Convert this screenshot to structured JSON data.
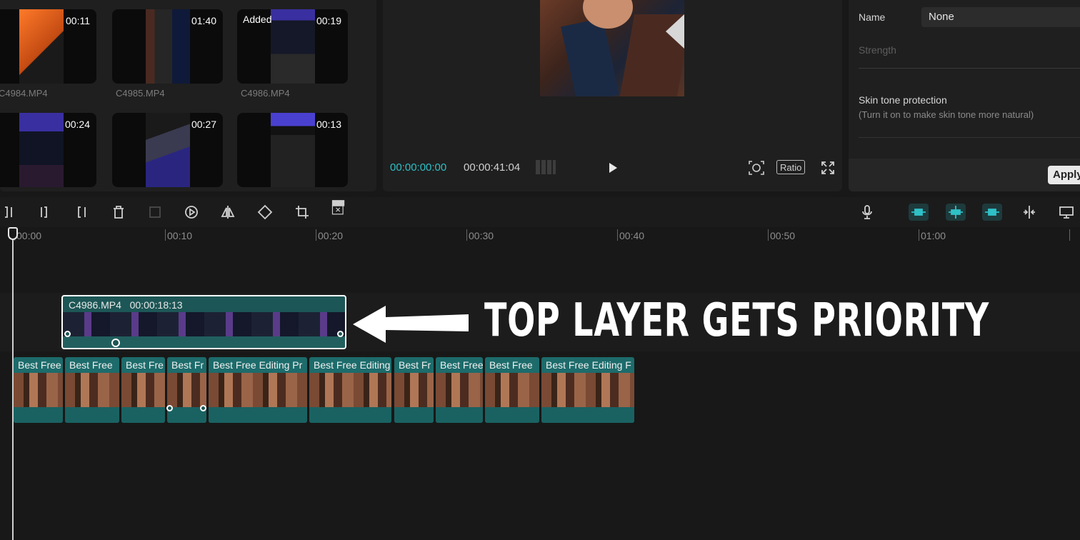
{
  "media": {
    "items": [
      {
        "duration": "00:11",
        "filename": "C4984.MP4",
        "added": ""
      },
      {
        "duration": "01:40",
        "filename": "C4985.MP4",
        "added": ""
      },
      {
        "duration": "00:19",
        "filename": "C4986.MP4",
        "added": "Added"
      },
      {
        "duration": "00:24",
        "filename": "",
        "added": ""
      },
      {
        "duration": "00:27",
        "filename": "",
        "added": ""
      },
      {
        "duration": "00:13",
        "filename": "",
        "added": ""
      }
    ]
  },
  "player": {
    "current_time": "00:00:00:00",
    "total_time": "00:00:41:04",
    "ratio_label": "Ratio"
  },
  "properties": {
    "name_label": "Name",
    "name_value": "None",
    "strength_label": "Strength",
    "skin_tone_label": "Skin tone protection",
    "skin_tone_help": "(Turn it on to make skin tone more natural)",
    "apply_label": "Apply"
  },
  "ruler": {
    "ticks": [
      "00:00",
      "00:10",
      "00:20",
      "00:30",
      "00:40",
      "00:50",
      "01:00"
    ]
  },
  "timeline": {
    "overlay_clip": {
      "name": "C4986.MP4",
      "duration": "00:00:18:13"
    },
    "main_clips": [
      "Best Free",
      "Best Free",
      "Best Fre",
      "Best Fr",
      "Best Free Editing Pr",
      "Best Free Editing",
      "Best Fr",
      "Best Free",
      "Best Free",
      "Best Free Editing F"
    ]
  },
  "annotation": {
    "caption": "TOP LAYER GETS PRIORITY"
  },
  "colors": {
    "accent_teal": "#2ec0c6",
    "clip_teal": "#1d6b6b",
    "background": "#181818"
  }
}
